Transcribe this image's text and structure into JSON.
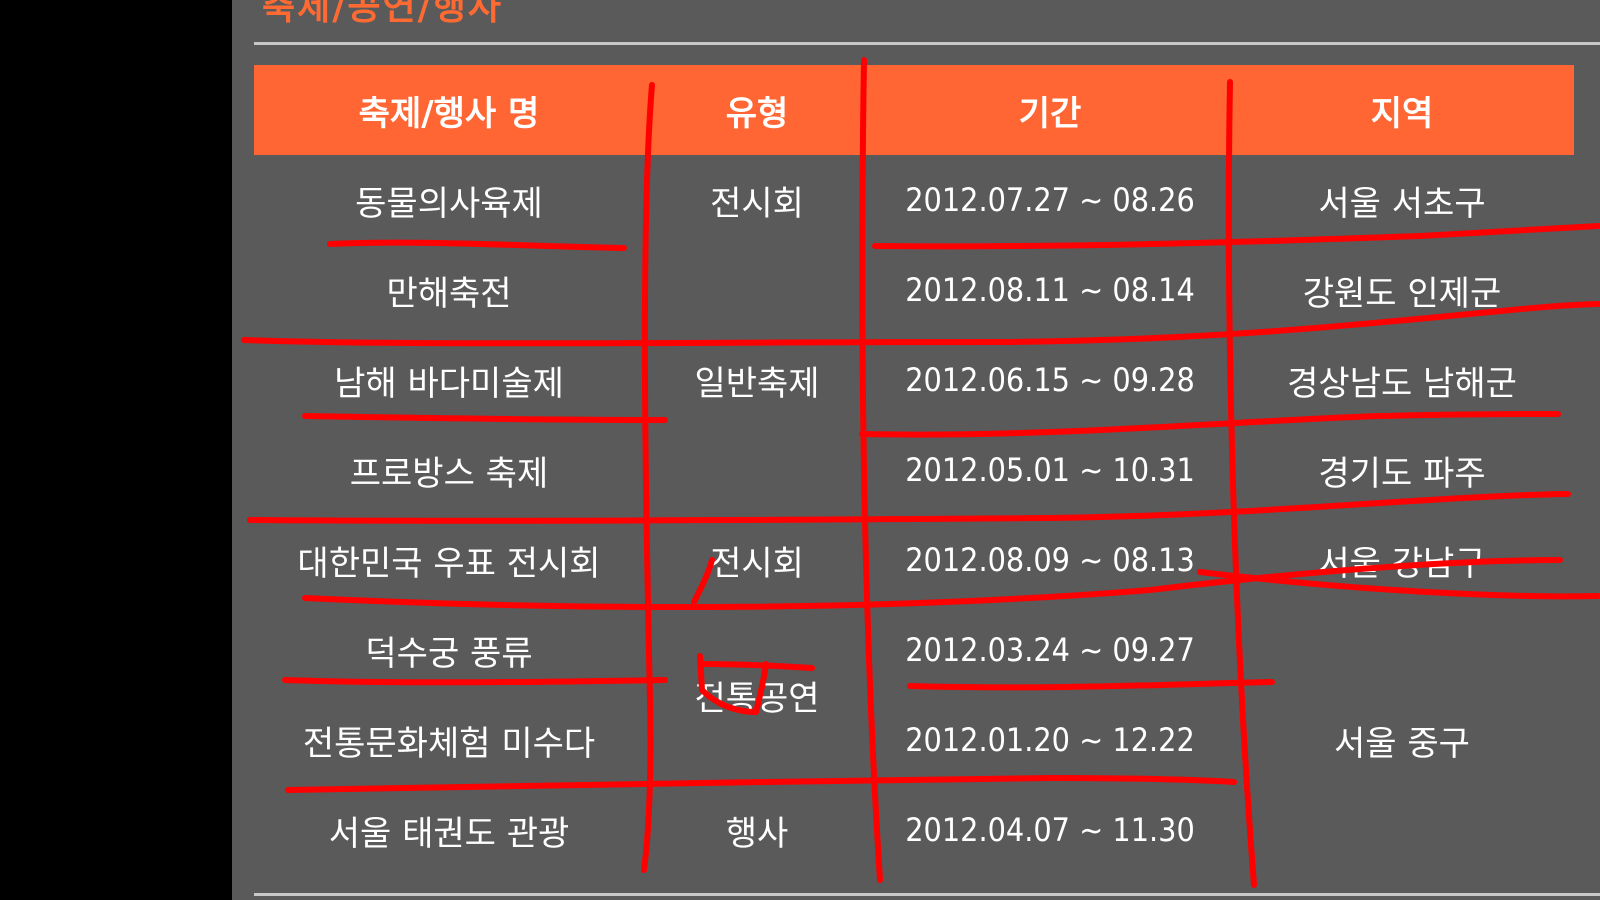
{
  "page": {
    "title": "축제/공연/행사"
  },
  "table": {
    "headers": [
      "축제/행사 명",
      "유형",
      "기간",
      "지역"
    ],
    "rows": [
      {
        "name": "동물의사육제",
        "type": "전시회",
        "period": "2012.07.27 ~ 08.26",
        "region": "서울 서초구"
      },
      {
        "name": "만해축전",
        "type": "",
        "period": "2012.08.11 ~ 08.14",
        "region": "강원도 인제군"
      },
      {
        "name": "남해 바다미술제",
        "type": "일반축제",
        "period": "2012.06.15 ~ 09.28",
        "region": "경상남도 남해군"
      },
      {
        "name": "프로방스 축제",
        "type": "",
        "period": "2012.05.01 ~ 10.31",
        "region": "경기도 파주"
      },
      {
        "name": "대한민국 우표 전시회",
        "type": "전시회",
        "period": "2012.08.09 ~ 08.13",
        "region": "서울 강남구"
      },
      {
        "name": "덕수궁 풍류",
        "type": "전통공연",
        "period": "2012.03.24 ~ 09.27",
        "region": "서울 중구"
      },
      {
        "name": "전통문화체험 미수다",
        "type": "",
        "period": "2012.01.20 ~ 12.22",
        "region": ""
      },
      {
        "name": "서울 태권도 관광",
        "type": "행사",
        "period": "2012.04.07 ~ 11.30",
        "region": ""
      }
    ]
  },
  "colors": {
    "header_bg": "#ff6633",
    "panel_bg": "#5a5a5a",
    "markup_stroke": "#ff0000"
  }
}
